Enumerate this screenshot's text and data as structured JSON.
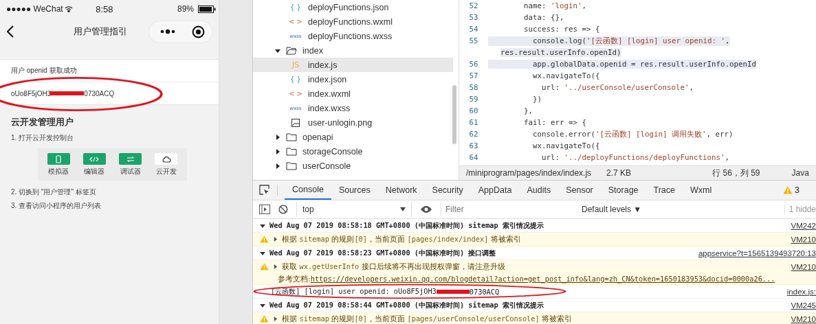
{
  "phone": {
    "status_bar": {
      "carrier": "●●●●● WeChat",
      "time": "8:58",
      "battery": "89%"
    },
    "nav": {
      "title": "用户管理指引"
    },
    "openid_card": {
      "label": "用户 openid 获取成功",
      "value_start": "oUo8F5jOH3",
      "value_end": "0730ACQ"
    },
    "guide": {
      "title": "云开发管理用户",
      "steps_before": [
        "1. 打开云开发控制台"
      ],
      "tools": [
        {
          "label": "模拟器",
          "kind": "phone",
          "highlighted": true
        },
        {
          "label": "编辑器",
          "kind": "code",
          "highlighted": true
        },
        {
          "label": "调试器",
          "kind": "switch",
          "highlighted": true
        },
        {
          "label": "云开发",
          "kind": "cloud",
          "highlighted": false
        }
      ],
      "steps_after": [
        "2. 切换到 \"用户管理\" 标签页",
        "3. 查看访问小程序的用户列表"
      ]
    }
  },
  "file_tree": [
    {
      "name": "deployFunctions.json",
      "kind": "json",
      "badge": "{ }",
      "selected": false
    },
    {
      "name": "deployFunctions.wxml",
      "kind": "wxml",
      "badge": "< >",
      "selected": false
    },
    {
      "name": "deployFunctions.wxss",
      "kind": "wxss",
      "badge": "wxss",
      "selected": false
    },
    {
      "name": "index",
      "kind": "folder",
      "expanded": true,
      "selected": false,
      "children": [
        {
          "name": "index.js",
          "kind": "js",
          "badge": "JS",
          "selected": true
        },
        {
          "name": "index.json",
          "kind": "json",
          "badge": "{ }",
          "selected": false
        },
        {
          "name": "index.wxml",
          "kind": "wxml",
          "badge": "< >",
          "selected": false
        },
        {
          "name": "index.wxss",
          "kind": "wxss",
          "badge": "wxss",
          "selected": false
        },
        {
          "name": "user-unlogin.png",
          "kind": "image",
          "selected": false
        }
      ]
    },
    {
      "name": "openapi",
      "kind": "folder",
      "expanded": false,
      "selected": false
    },
    {
      "name": "storageConsole",
      "kind": "folder",
      "expanded": false,
      "selected": false
    },
    {
      "name": "userConsole",
      "kind": "folder",
      "expanded": false,
      "selected": false
    }
  ],
  "editor": {
    "lines": [
      {
        "number": "52",
        "highlighted": false,
        "segments": [
          {
            "text": "        name: ",
            "kind": "plain"
          },
          {
            "text": "'login'",
            "kind": "string"
          },
          {
            "text": ",",
            "kind": "plain"
          }
        ]
      },
      {
        "number": "53",
        "highlighted": false,
        "segments": [
          {
            "text": "        data: {},",
            "kind": "plain"
          }
        ]
      },
      {
        "number": "54",
        "highlighted": false,
        "segments": [
          {
            "text": "        success: res => {",
            "kind": "plain"
          }
        ]
      },
      {
        "number": "55",
        "highlighted": true,
        "segments": [
          {
            "text": "          console.log(",
            "kind": "plain"
          },
          {
            "text": "'[云函数] [login] user openid: '",
            "kind": "string"
          },
          {
            "text": ",",
            "kind": "plain"
          }
        ],
        "continuation": "res.result.userInfo.openId)"
      },
      {
        "number": "56",
        "highlighted": true,
        "segments": [
          {
            "text": "          app.globalData.openid = res.result.userInfo.openId",
            "kind": "plain"
          }
        ]
      },
      {
        "number": "57",
        "highlighted": false,
        "segments": [
          {
            "text": "          wx.navigateTo({",
            "kind": "plain"
          }
        ]
      },
      {
        "number": "58",
        "highlighted": false,
        "segments": [
          {
            "text": "            url: ",
            "kind": "plain"
          },
          {
            "text": "'../userConsole/userConsole'",
            "kind": "string"
          },
          {
            "text": ",",
            "kind": "plain"
          }
        ]
      },
      {
        "number": "59",
        "highlighted": false,
        "segments": [
          {
            "text": "          })",
            "kind": "plain"
          }
        ]
      },
      {
        "number": "60",
        "highlighted": false,
        "segments": [
          {
            "text": "        },",
            "kind": "plain"
          }
        ]
      },
      {
        "number": "61",
        "highlighted": false,
        "segments": [
          {
            "text": "        fail: err => {",
            "kind": "plain"
          }
        ]
      },
      {
        "number": "62",
        "highlighted": false,
        "segments": [
          {
            "text": "          console.error(",
            "kind": "plain"
          },
          {
            "text": "'[云函数] [login] 调用失败'",
            "kind": "string"
          },
          {
            "text": ", err)",
            "kind": "plain"
          }
        ]
      },
      {
        "number": "63",
        "highlighted": false,
        "segments": [
          {
            "text": "          wx.navigateTo({",
            "kind": "plain"
          }
        ]
      },
      {
        "number": "64",
        "highlighted": false,
        "segments": [
          {
            "text": "            url: ",
            "kind": "plain"
          },
          {
            "text": "'../deployFunctions/deployFunctions'",
            "kind": "string"
          },
          {
            "text": ",",
            "kind": "plain"
          }
        ]
      }
    ],
    "status": {
      "path": "/miniprogram/pages/index/index.js",
      "size": "2.7 KB",
      "position": "行 56，列 59",
      "language": "Java"
    }
  },
  "console": {
    "tabs": [
      {
        "label": "Console",
        "selected": true
      },
      {
        "label": "Sources",
        "selected": false
      },
      {
        "label": "Network",
        "selected": false
      },
      {
        "label": "Security",
        "selected": false
      },
      {
        "label": "AppData",
        "selected": false
      },
      {
        "label": "Audits",
        "selected": false
      },
      {
        "label": "Sensor",
        "selected": false
      },
      {
        "label": "Storage",
        "selected": false
      },
      {
        "label": "Trace",
        "selected": false
      },
      {
        "label": "Wxml",
        "selected": false
      }
    ],
    "warning_count": "3",
    "toolbar": {
      "context": "top",
      "filter_placeholder": "Filter",
      "levels": "Default levels ▼",
      "hidden": "1 hidde"
    },
    "messages": [
      {
        "kind": "group",
        "text": "Wed Aug 07 2019 08:58:18 GMT+0800 (中国标准时间) sitemap 索引情况提示",
        "source": "VM242"
      },
      {
        "kind": "warn",
        "segments": [
          {
            "text": "根据 ",
            "kind": "plain"
          },
          {
            "text": "sitemap",
            "kind": "code"
          },
          {
            "text": " 的规则",
            "kind": "plain"
          },
          {
            "text": "[0]",
            "kind": "code"
          },
          {
            "text": "，当前页面 ",
            "kind": "plain"
          },
          {
            "text": "[pages/index/index]",
            "kind": "code"
          },
          {
            "text": " 将被索引",
            "kind": "plain"
          }
        ],
        "source": "VM210"
      },
      {
        "kind": "group",
        "text": "Wed Aug 07 2019 08:58:23 GMT+0800 (中国标准时间) 接口调整",
        "source": "appservice?t=1565139493720:13"
      },
      {
        "kind": "warn",
        "segments": [
          {
            "text": "获取 ",
            "kind": "plain"
          },
          {
            "text": "wx.getUserInfo",
            "kind": "code"
          },
          {
            "text": " 接口后续将不再出现授权弹窗，请注意升级",
            "kind": "plain"
          }
        ],
        "note": "参考文档: ",
        "link": "https://developers.weixin.qq.com/blogdetail?action=get_post_info&lang=zh_CN&token=1650183953&docid=0000a26...",
        "source": "VM210"
      },
      {
        "kind": "log",
        "text": "[云函数] [login] user openid:  oUo8F5jOH3",
        "text_end": "0730ACQ",
        "source": "index.js:"
      },
      {
        "kind": "group",
        "text": "Wed Aug 07 2019 08:58:44 GMT+0800 (中国标准时间) sitemap 索引情况提示",
        "source": "VM245"
      },
      {
        "kind": "warn",
        "segments": [
          {
            "text": "根据 ",
            "kind": "plain"
          },
          {
            "text": "sitemap",
            "kind": "code"
          },
          {
            "text": " 的规则",
            "kind": "plain"
          },
          {
            "text": "[0]",
            "kind": "code"
          },
          {
            "text": "，当前页面 ",
            "kind": "plain"
          },
          {
            "text": "[pages/userConsole/userConsole]",
            "kind": "code"
          },
          {
            "text": " 将被索引",
            "kind": "plain"
          }
        ],
        "source": "VM210"
      }
    ]
  }
}
